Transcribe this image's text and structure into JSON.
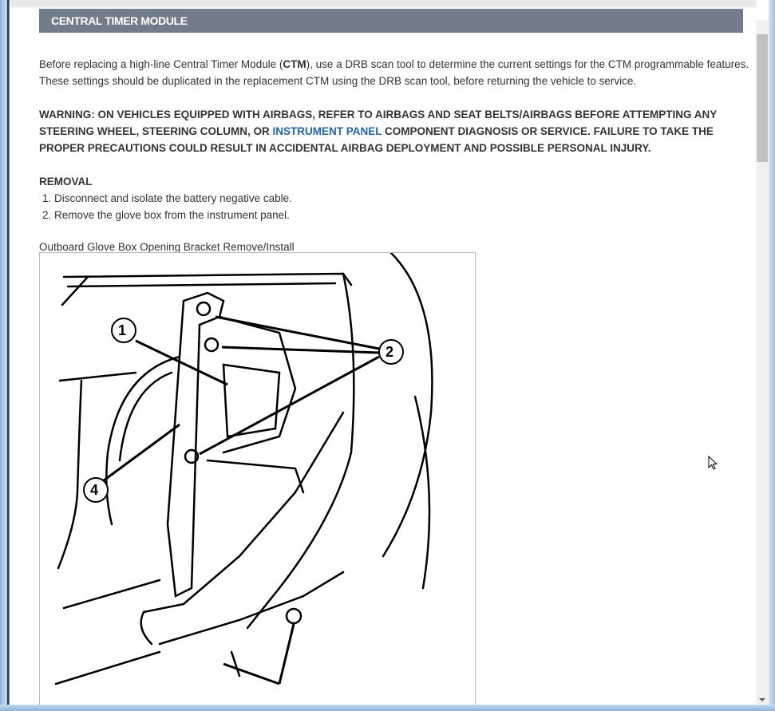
{
  "section": {
    "title": "CENTRAL TIMER MODULE"
  },
  "intro": {
    "before": "Before replacing a high-line Central Timer Module (",
    "bold": "CTM",
    "after": "), use a DRB scan tool to determine the current settings for the CTM programmable features. These settings should be duplicated in the replacement CTM using the DRB scan tool, before returning the vehicle to service."
  },
  "warning": {
    "before": "WARNING: ON VEHICLES EQUIPPED WITH AIRBAGS, REFER TO AIRBAGS AND SEAT BELTS/AIRBAGS BEFORE ATTEMPTING ANY STEERING WHEEL, STEERING COLUMN, OR ",
    "link": "INSTRUMENT PANEL",
    "after": " COMPONENT DIAGNOSIS OR SERVICE. FAILURE TO TAKE THE PROPER PRECAUTIONS COULD RESULT IN ACCIDENTAL AIRBAG DEPLOYMENT AND POSSIBLE PERSONAL INJURY."
  },
  "removal": {
    "heading": "REMOVAL",
    "steps": [
      "Disconnect and isolate the battery negative cable.",
      "Remove the glove box from the instrument panel."
    ]
  },
  "figure": {
    "caption": "Outboard Glove Box Opening Bracket Remove/Install",
    "callouts": [
      "1",
      "2",
      "4"
    ]
  }
}
